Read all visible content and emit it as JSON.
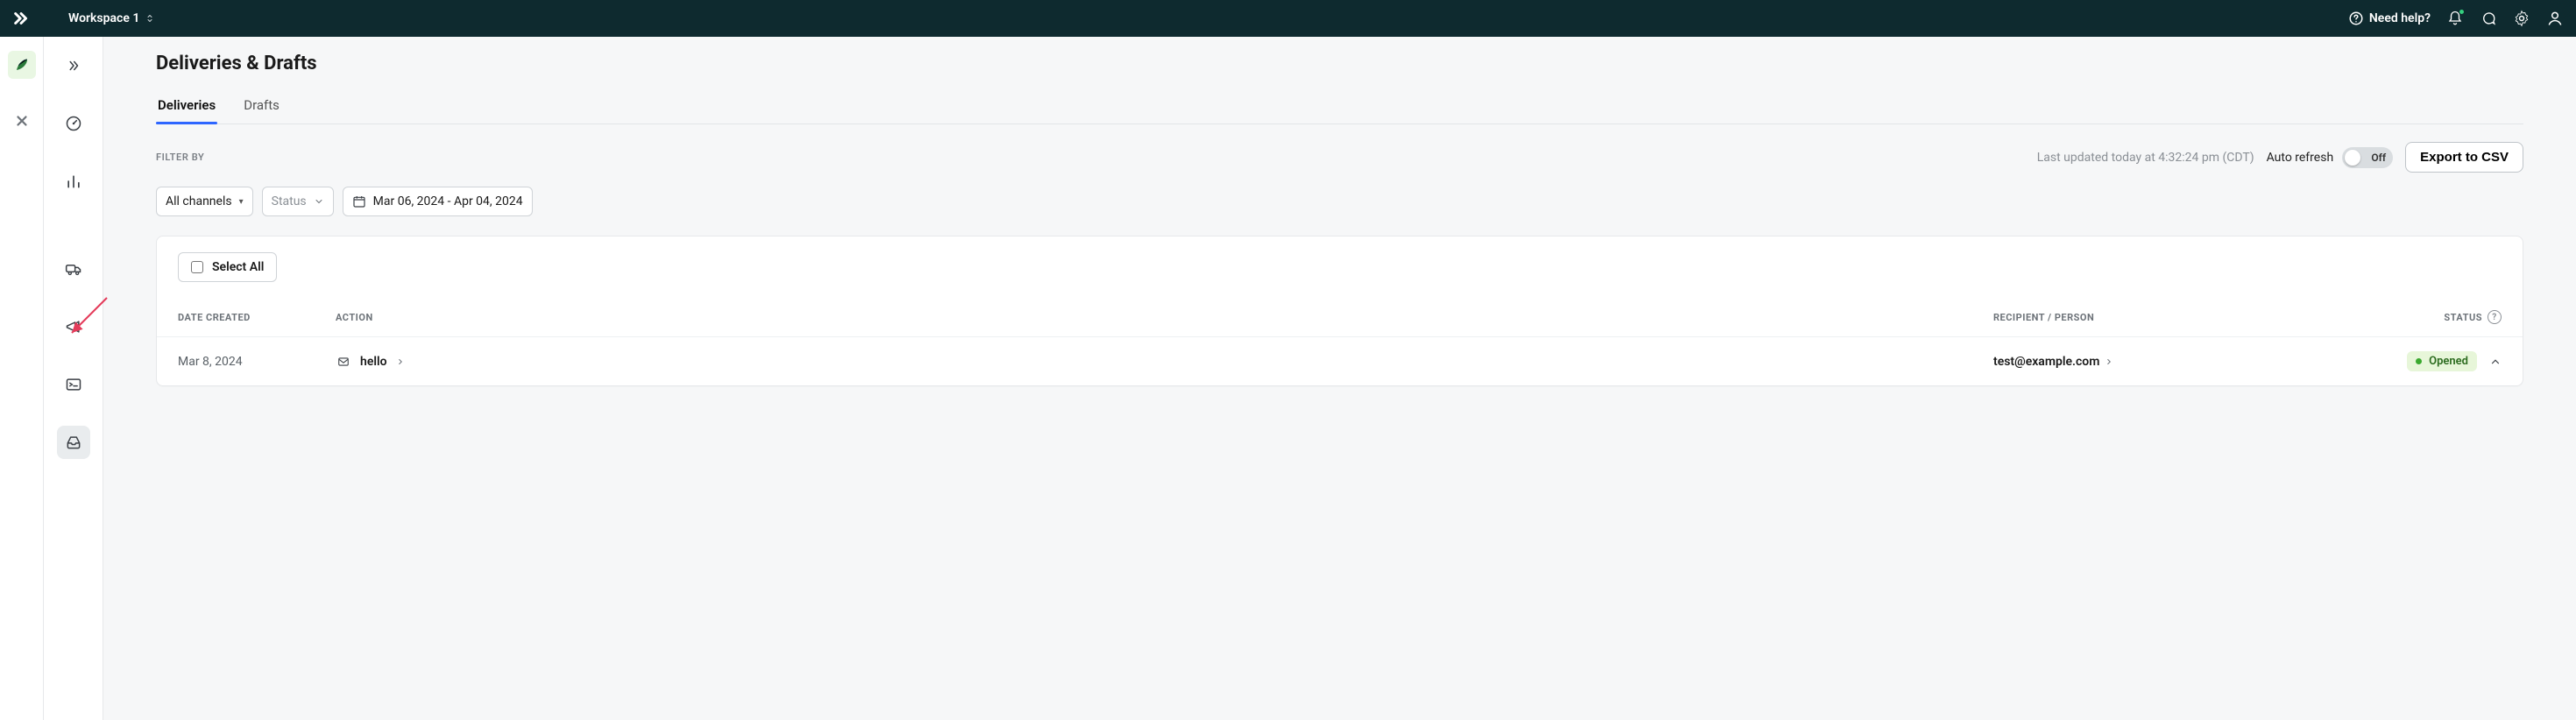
{
  "workspace": {
    "label": "Workspace 1"
  },
  "header": {
    "need_help_label": "Need help?"
  },
  "page": {
    "title": "Deliveries & Drafts",
    "tabs": [
      {
        "label": "Deliveries",
        "active": true
      },
      {
        "label": "Drafts",
        "active": false
      }
    ],
    "filter_by_label": "FILTER BY",
    "last_updated": "Last updated today at 4:32:24 pm (CDT)",
    "auto_refresh_label": "Auto refresh",
    "auto_refresh_state": "Off",
    "export_label": "Export to CSV",
    "filters": {
      "channel": "All channels",
      "status": "Status",
      "date_range": "Mar 06, 2024 - Apr 04, 2024"
    },
    "select_all_label": "Select All",
    "columns": {
      "date_created": "DATE CREATED",
      "action": "ACTION",
      "recipient": "RECIPIENT / PERSON",
      "status": "STATUS"
    },
    "rows": [
      {
        "date": "Mar 8, 2024",
        "action": "hello",
        "recipient": "test@example.com",
        "status": "Opened"
      }
    ]
  }
}
